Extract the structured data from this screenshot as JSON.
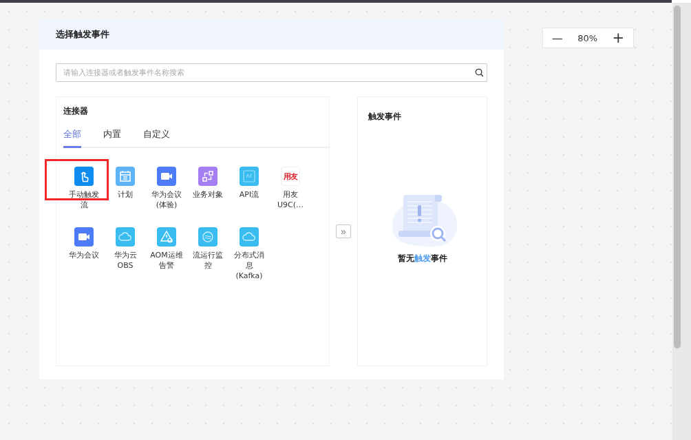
{
  "panel": {
    "title": "选择触发事件"
  },
  "search": {
    "placeholder": "请输入连接器或者触发事件名称搜索"
  },
  "connectors": {
    "title": "连接器",
    "tabs": [
      {
        "label": "全部",
        "selected": true
      },
      {
        "label": "内置",
        "selected": false
      },
      {
        "label": "自定义",
        "selected": false
      }
    ],
    "items": [
      {
        "label": "手动触发流",
        "kind": "hand",
        "color": "#0e8cf0",
        "highlighted": true
      },
      {
        "label": "计划",
        "kind": "calendar",
        "color": "#5fb3f7",
        "highlighted": false
      },
      {
        "label": "华为会议(体验)",
        "kind": "video",
        "color": "#4d7cf6",
        "highlighted": false
      },
      {
        "label": "业务对象",
        "kind": "object",
        "color": "#a47ef2",
        "highlighted": false
      },
      {
        "label": "API流",
        "kind": "api",
        "color": "#3bbcf0",
        "highlighted": false
      },
      {
        "label": "用友U9C(…",
        "kind": "logo",
        "logo_text": "用友",
        "color": "#ffffff",
        "highlighted": false
      },
      {
        "label": "华为会议",
        "kind": "video",
        "color": "#4d7cf6",
        "highlighted": false
      },
      {
        "label": "华为云OBS",
        "kind": "cloud",
        "color": "#3bbcf0",
        "highlighted": false
      },
      {
        "label": "AOM运维告警",
        "kind": "alert",
        "color": "#3bbcf0",
        "highlighted": false
      },
      {
        "label": "流运行监控",
        "kind": "flow",
        "color": "#3bbcf0",
        "highlighted": false
      },
      {
        "label": "分布式消息(Kafka)",
        "kind": "cloud",
        "color": "#3bbcf0",
        "highlighted": false
      }
    ]
  },
  "move_button": {
    "label": "»"
  },
  "events": {
    "title": "触发事件",
    "empty": {
      "before": "暂无",
      "highlight": "触发",
      "after": "事件"
    }
  },
  "zoom": {
    "minus": "—",
    "value": "80%",
    "plus": "+"
  }
}
